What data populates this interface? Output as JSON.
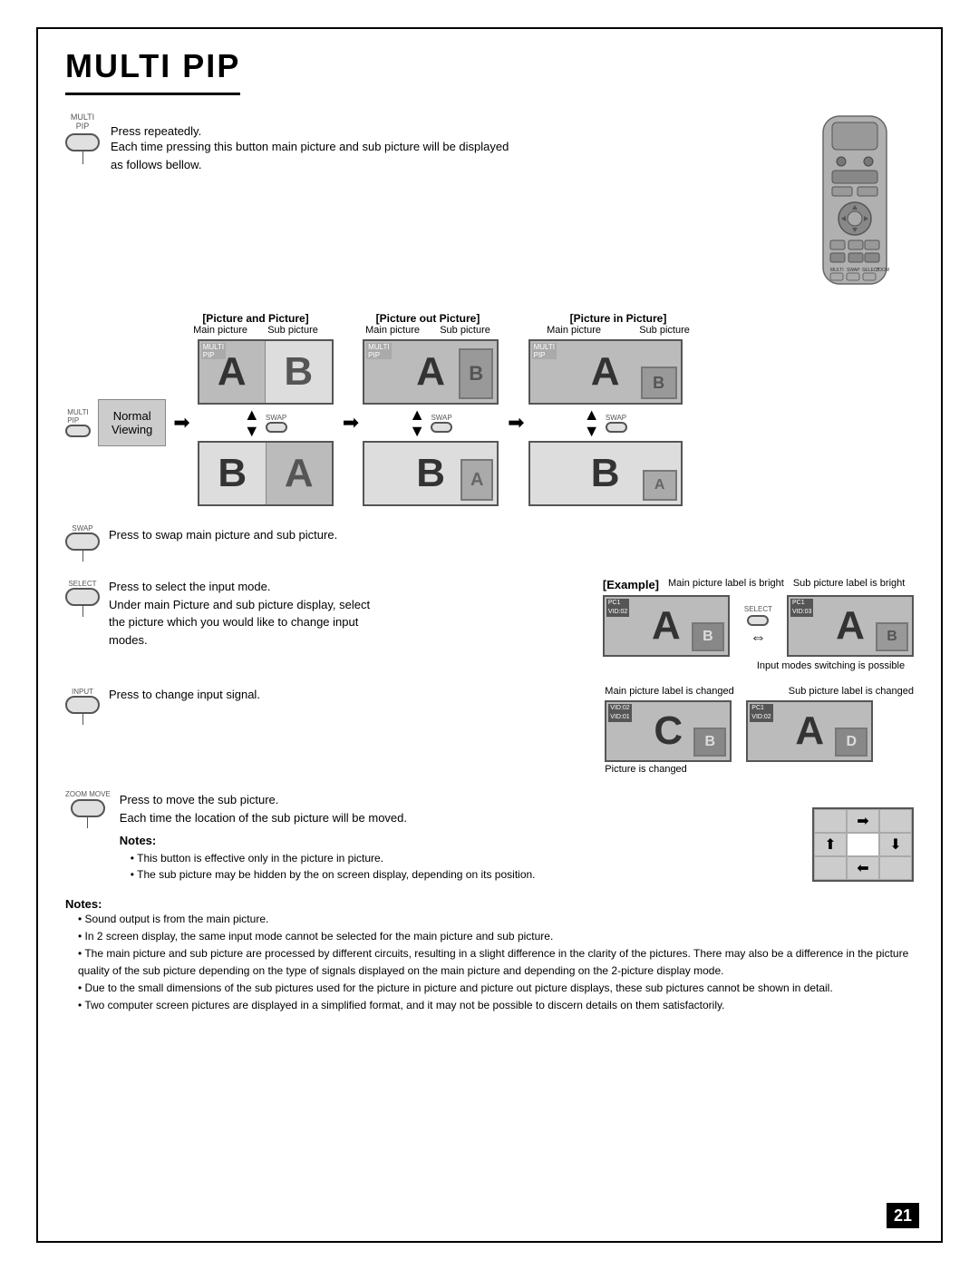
{
  "page": {
    "title": "MULTI PIP",
    "number": "21"
  },
  "intro": {
    "multi_pip_label": "MULTI\nPIP",
    "press_repeatedly": "Press repeatedly.",
    "description": "Each time pressing this button main picture and sub picture will be displayed\nas follows bellow."
  },
  "sections": {
    "picture_and_picture": "[Picture and Picture]",
    "picture_out_picture": "[Picture out Picture]",
    "picture_in_picture": "[Picture in Picture]",
    "main_picture": "Main picture",
    "sub_picture": "Sub picture",
    "normal_viewing": "Normal\nViewing",
    "swap_label": "SWAP",
    "swap_text": "Press to swap main\npicture and sub picture.",
    "select_label": "SELECT",
    "select_text1": "Press to select the input mode.",
    "select_text2": "Under main Picture and sub picture display, select\nthe picture which you would like to change input\nmodes.",
    "example_label": "[Example]",
    "main_bright": "Main picture label is bright",
    "sub_bright": "Sub picture label is bright",
    "input_modes_switching": "Input modes switching is possible",
    "input_label": "INPUT",
    "input_text": "Press to change input signal.",
    "main_changed": "Main picture label is changed",
    "sub_changed": "Sub picture label is changed",
    "picture_is_changed": "Picture is changed",
    "zoom_label": "ZOOM\nMOVE",
    "zoom_text1": "Press to move the sub picture.",
    "zoom_text2": "Each time the location of the sub picture will be moved.",
    "notes_inner_title": "Notes:",
    "notes_inner_items": [
      "This button is effective only in the picture in picture.",
      "The sub picture may be hidden by the on screen display, depending on its position."
    ],
    "notes_main_title": "Notes:",
    "notes_main_items": [
      "Sound output is from the main picture.",
      "In 2 screen display, the same input mode cannot be selected for the main picture and sub picture.",
      "The main picture and sub picture are processed by different circuits, resulting in a slight difference in the clarity of the pictures. There may also be a difference in the picture quality of the sub picture depending on the type of signals displayed on the main picture and depending on the 2-picture display mode.",
      "Due to the small dimensions of the sub pictures used for the picture in picture and picture out picture displays, these sub pictures cannot be shown in detail.",
      "Two computer screen pictures are displayed in a simplified format, and it may not be possible to discern details on them satisfactorily."
    ]
  }
}
